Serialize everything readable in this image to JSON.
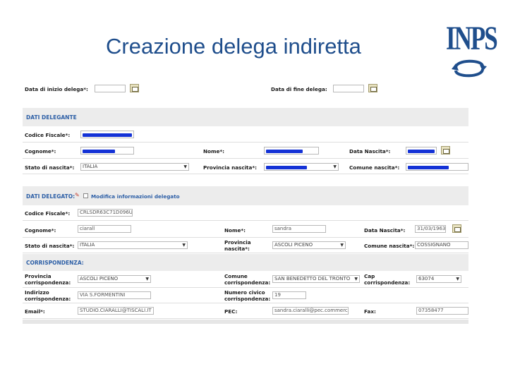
{
  "slide": {
    "title": "Creazione delega indiretta",
    "logo_text": "INPS",
    "logo_icon": "inps-circular-arrows-logo",
    "brand_color": "#1f4e8c"
  },
  "form": {
    "top": {
      "start_label": "Data di inizio delega*:",
      "end_label": "Data di fine delega:",
      "start_value": "",
      "end_value": ""
    },
    "delegante": {
      "section_title": "DATI DELEGANTE",
      "codice_fiscale_label": "Codice Fiscale*:",
      "cognome_label": "Cognome*:",
      "nome_label": "Nome*:",
      "data_nascita_label": "Data Nascita*:",
      "stato_label": "Stato di nascita*:",
      "stato_value": "ITALIA",
      "provincia_label": "Provincia nascita*:",
      "comune_label": "Comune nascita*:"
    },
    "delegato": {
      "section_title": "DATI DELEGATO:",
      "modify_label": "Modifica informazioni delegato",
      "codice_fiscale_label": "Codice Fiscale*:",
      "codice_fiscale_value": "CRLSDR63C71D096U",
      "cognome_label": "Cognome*:",
      "cognome_value": "ciarall",
      "nome_label": "Nome*:",
      "nome_value": "sandra",
      "data_nascita_label": "Data Nascita*:",
      "data_nascita_value": "31/03/1963",
      "stato_label": "Stato di nascita*:",
      "stato_value": "ITALIA",
      "provincia_label": "Provincia nascita*:",
      "provincia_value": "ASCOLI PICENO",
      "comune_label": "Comune nascita*:",
      "comune_value": "COSSIGNANO"
    },
    "corrispondenza": {
      "section_title": "CORRISPONDENZA:",
      "provincia_label": "Provincia corrispondenza:",
      "provincia_value": "ASCOLI PICENO",
      "comune_label": "Comune corrispondenza:",
      "comune_value": "SAN BENEDETTO DEL TRONTO",
      "cap_label": "Cap corrispondenza:",
      "cap_value": "63074",
      "indirizzo_label": "Indirizzo corrispondenza:",
      "indirizzo_value": "VIA S.FORMENTINI",
      "civico_label": "Numero civico corrispondenza:",
      "civico_value": "19",
      "email_label": "Email*:",
      "email_value": "STUDIO.CIARALLI@TISCALI.IT",
      "pec_label": "PEC:",
      "pec_value": "sandra.ciaralli@pec.commerciali",
      "fax_label": "Fax:",
      "fax_value": "07358477"
    },
    "colors": {
      "section_title": "#2d5fa6",
      "redaction": "#1432d6",
      "row_grey": "#ececec"
    }
  }
}
